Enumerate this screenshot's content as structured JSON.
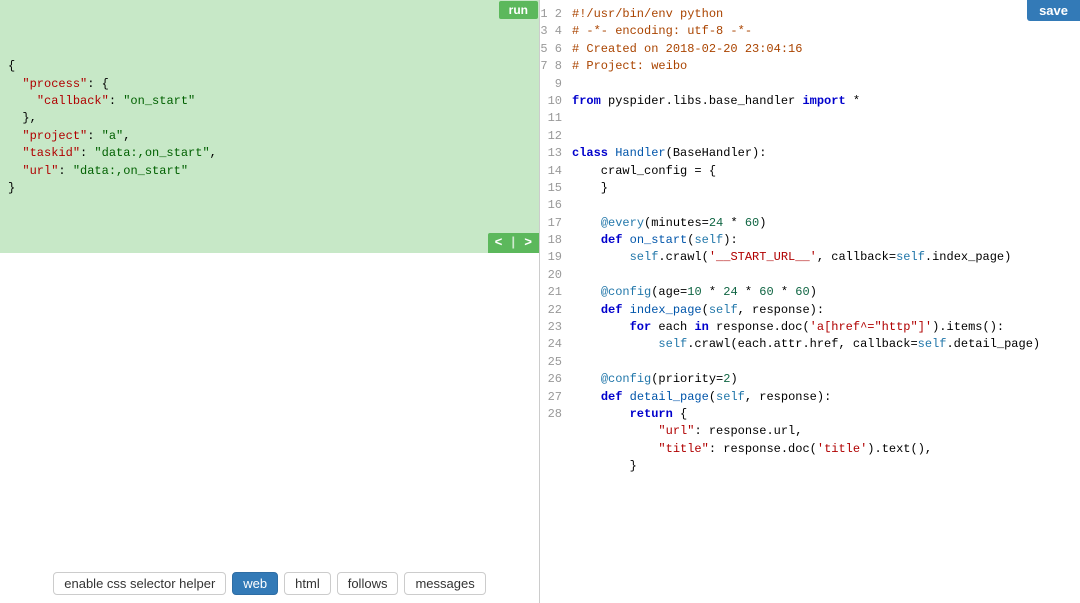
{
  "buttons": {
    "run": "run",
    "save": "save",
    "prev": "<",
    "sep": "|",
    "next": ">"
  },
  "task_tokens": [
    {
      "t": "{",
      "c": ""
    },
    {
      "nl": 1
    },
    {
      "t": "  ",
      "c": ""
    },
    {
      "t": "\"process\"",
      "c": "kw"
    },
    {
      "t": ": {",
      "c": ""
    },
    {
      "nl": 1
    },
    {
      "t": "    ",
      "c": ""
    },
    {
      "t": "\"callback\"",
      "c": "kw"
    },
    {
      "t": ": ",
      "c": ""
    },
    {
      "t": "\"on_start\"",
      "c": "str"
    },
    {
      "nl": 1
    },
    {
      "t": "  },",
      "c": ""
    },
    {
      "nl": 1
    },
    {
      "t": "  ",
      "c": ""
    },
    {
      "t": "\"project\"",
      "c": "kw"
    },
    {
      "t": ": ",
      "c": ""
    },
    {
      "t": "\"a\"",
      "c": "str"
    },
    {
      "t": ",",
      "c": ""
    },
    {
      "nl": 1
    },
    {
      "t": "  ",
      "c": ""
    },
    {
      "t": "\"taskid\"",
      "c": "kw"
    },
    {
      "t": ": ",
      "c": ""
    },
    {
      "t": "\"data:,on_start\"",
      "c": "str"
    },
    {
      "t": ",",
      "c": ""
    },
    {
      "nl": 1
    },
    {
      "t": "  ",
      "c": ""
    },
    {
      "t": "\"url\"",
      "c": "kw"
    },
    {
      "t": ": ",
      "c": ""
    },
    {
      "t": "\"data:,on_start\"",
      "c": "str"
    },
    {
      "nl": 1
    },
    {
      "t": "}",
      "c": ""
    }
  ],
  "bottom_tabs": [
    {
      "label": "enable css selector helper",
      "active": false
    },
    {
      "label": "web",
      "active": true
    },
    {
      "label": "html",
      "active": false
    },
    {
      "label": "follows",
      "active": false
    },
    {
      "label": "messages",
      "active": false
    }
  ],
  "code_lines": [
    [
      {
        "t": "#!/usr/bin/env python",
        "c": "cm"
      }
    ],
    [
      {
        "t": "# -*- encoding: utf-8 -*-",
        "c": "cm"
      }
    ],
    [
      {
        "t": "# Created on 2018-02-20 23:04:16",
        "c": "cm"
      }
    ],
    [
      {
        "t": "# Project: weibo",
        "c": "cm"
      }
    ],
    [],
    [
      {
        "t": "from ",
        "c": "kw2"
      },
      {
        "t": "pyspider.libs.base_handler ",
        "c": ""
      },
      {
        "t": "import ",
        "c": "kw2"
      },
      {
        "t": "*",
        "c": ""
      }
    ],
    [],
    [],
    [
      {
        "t": "class ",
        "c": "kw2"
      },
      {
        "t": "Handler",
        "c": "fn"
      },
      {
        "t": "(BaseHandler):",
        "c": ""
      }
    ],
    [
      {
        "t": "    crawl_config = {",
        "c": ""
      }
    ],
    [
      {
        "t": "    }",
        "c": ""
      }
    ],
    [],
    [
      {
        "t": "    ",
        "c": ""
      },
      {
        "t": "@every",
        "c": "dc"
      },
      {
        "t": "(minutes=",
        "c": ""
      },
      {
        "t": "24",
        "c": "nm"
      },
      {
        "t": " * ",
        "c": ""
      },
      {
        "t": "60",
        "c": "nm"
      },
      {
        "t": ")",
        "c": ""
      }
    ],
    [
      {
        "t": "    ",
        "c": ""
      },
      {
        "t": "def ",
        "c": "kw2"
      },
      {
        "t": "on_start",
        "c": "fn"
      },
      {
        "t": "(",
        "c": ""
      },
      {
        "t": "self",
        "c": "sf"
      },
      {
        "t": "):",
        "c": ""
      }
    ],
    [
      {
        "t": "        ",
        "c": ""
      },
      {
        "t": "self",
        "c": "sf"
      },
      {
        "t": ".crawl(",
        "c": ""
      },
      {
        "t": "'__START_URL__'",
        "c": "st"
      },
      {
        "t": ", callback=",
        "c": ""
      },
      {
        "t": "self",
        "c": "sf"
      },
      {
        "t": ".index_page)",
        "c": ""
      }
    ],
    [],
    [
      {
        "t": "    ",
        "c": ""
      },
      {
        "t": "@config",
        "c": "dc"
      },
      {
        "t": "(age=",
        "c": ""
      },
      {
        "t": "10",
        "c": "nm"
      },
      {
        "t": " * ",
        "c": ""
      },
      {
        "t": "24",
        "c": "nm"
      },
      {
        "t": " * ",
        "c": ""
      },
      {
        "t": "60",
        "c": "nm"
      },
      {
        "t": " * ",
        "c": ""
      },
      {
        "t": "60",
        "c": "nm"
      },
      {
        "t": ")",
        "c": ""
      }
    ],
    [
      {
        "t": "    ",
        "c": ""
      },
      {
        "t": "def ",
        "c": "kw2"
      },
      {
        "t": "index_page",
        "c": "fn"
      },
      {
        "t": "(",
        "c": ""
      },
      {
        "t": "self",
        "c": "sf"
      },
      {
        "t": ", response):",
        "c": ""
      }
    ],
    [
      {
        "t": "        ",
        "c": ""
      },
      {
        "t": "for ",
        "c": "kw2"
      },
      {
        "t": "each ",
        "c": ""
      },
      {
        "t": "in ",
        "c": "kw2"
      },
      {
        "t": "response.doc(",
        "c": ""
      },
      {
        "t": "'a[href^=\"http\"]'",
        "c": "st"
      },
      {
        "t": ").items():",
        "c": ""
      }
    ],
    [
      {
        "t": "            ",
        "c": ""
      },
      {
        "t": "self",
        "c": "sf"
      },
      {
        "t": ".crawl(each.attr.href, callback=",
        "c": ""
      },
      {
        "t": "self",
        "c": "sf"
      },
      {
        "t": ".detail_page)",
        "c": ""
      }
    ],
    [],
    [
      {
        "t": "    ",
        "c": ""
      },
      {
        "t": "@config",
        "c": "dc"
      },
      {
        "t": "(priority=",
        "c": ""
      },
      {
        "t": "2",
        "c": "nm"
      },
      {
        "t": ")",
        "c": ""
      }
    ],
    [
      {
        "t": "    ",
        "c": ""
      },
      {
        "t": "def ",
        "c": "kw2"
      },
      {
        "t": "detail_page",
        "c": "fn"
      },
      {
        "t": "(",
        "c": ""
      },
      {
        "t": "self",
        "c": "sf"
      },
      {
        "t": ", response):",
        "c": ""
      }
    ],
    [
      {
        "t": "        ",
        "c": ""
      },
      {
        "t": "return ",
        "c": "kw2"
      },
      {
        "t": "{",
        "c": ""
      }
    ],
    [
      {
        "t": "            ",
        "c": ""
      },
      {
        "t": "\"url\"",
        "c": "st"
      },
      {
        "t": ": response.url,",
        "c": ""
      }
    ],
    [
      {
        "t": "            ",
        "c": ""
      },
      {
        "t": "\"title\"",
        "c": "st"
      },
      {
        "t": ": response.doc(",
        "c": ""
      },
      {
        "t": "'title'",
        "c": "st"
      },
      {
        "t": ").text(),",
        "c": ""
      }
    ],
    [
      {
        "t": "        }",
        "c": ""
      }
    ],
    []
  ]
}
